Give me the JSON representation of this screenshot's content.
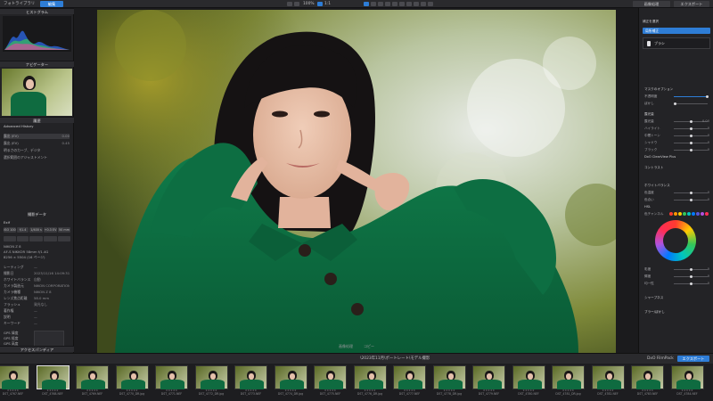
{
  "topbar": {
    "app_tab": "フォトライブラリ",
    "edit_tab": "編集",
    "zoom": "100%",
    "fit": "1:1",
    "right_button_1": "画像処理",
    "right_button_2": "エクスポート",
    "right_button_3": "テスト"
  },
  "left": {
    "histogram_title": "ヒストグラム",
    "navigator_title": "ナビゲーター",
    "history_title": "履歴",
    "history_group": "Advanced History",
    "history_items": [
      {
        "label": "露出 (EV)",
        "value": "0.00"
      },
      {
        "label": "露出 (EV)",
        "value": "0.45"
      },
      {
        "label": "明るさのカーブ、デジタ",
        "value": ""
      },
      {
        "label": "選択範囲のアジャストメント",
        "value": ""
      }
    ],
    "meta_title": "撮影データ",
    "exif_label": "Exif",
    "exif_chips": [
      "ISO 100",
      "f/1.4",
      "1/400 s",
      "+0.3 EV",
      "50 mm"
    ],
    "camera": "NIKON Z 8",
    "lens": "AF-S NIKKOR 58mm f/1.4G",
    "size": "8256 × 5504 (16 ページ)",
    "info_rows": [
      {
        "label": "レーティング",
        "value": "—"
      },
      {
        "label": "撮影日",
        "value": "2023/11/16 14:09:31"
      },
      {
        "label": "ホワイトバランス",
        "value": "自動"
      },
      {
        "label": "カメラ製造元",
        "value": "NIKON CORPORATION"
      },
      {
        "label": "カメラ機種",
        "value": "NIKON Z 8"
      },
      {
        "label": "レンズ焦点距離",
        "value": "58.0 mm"
      },
      {
        "label": "フラッシュ",
        "value": "発光なし"
      },
      {
        "label": "著作権",
        "value": "—"
      },
      {
        "label": "説明",
        "value": "—"
      },
      {
        "label": "キーワード",
        "value": "—"
      }
    ],
    "gps_rows": [
      "GPS 緯度",
      "GPS 経度",
      "GPS 高度"
    ],
    "bottom_title": "アクセスパンディア"
  },
  "right": {
    "title": "補正を選択",
    "mode": "局所補正",
    "tool": "ブラシ",
    "section1": "マスクのオプション",
    "opacity_label": "不透明度",
    "feather_label": "ぼかし",
    "section2": "露光量",
    "rows": [
      {
        "label": "露光量",
        "value": "0.00"
      },
      {
        "label": "ハイライト",
        "value": "0"
      },
      {
        "label": "中間トーン",
        "value": "0"
      },
      {
        "label": "シャドウ",
        "value": "0"
      },
      {
        "label": "ブラック",
        "value": "0"
      }
    ],
    "section3": "DxO ClearView Plus",
    "section4": "コントラスト",
    "section5": "ホワイトバランス",
    "wb_rows": [
      {
        "label": "色温度",
        "value": "0"
      },
      {
        "label": "色合い",
        "value": "0"
      }
    ],
    "section6": "HSL",
    "color_label": "色チャンネル",
    "hsl_rows": [
      {
        "label": "彩度",
        "value": "0"
      },
      {
        "label": "輝度",
        "value": "0"
      },
      {
        "label": "均一性",
        "value": "0"
      }
    ],
    "section7": "シャープネス",
    "section8": "ブラー/ぼかし",
    "swatch_colors": [
      "#ff3b30",
      "#ff9500",
      "#ffcc00",
      "#34c759",
      "#00c7be",
      "#007aff",
      "#5856d6",
      "#af52de",
      "#ff2d55"
    ]
  },
  "filmbar": {
    "path": "\\2023年11月\\ポートレート\\モデル撮影",
    "center_a": "画像処理",
    "center_b": "コピー",
    "collection": "DxO FilmPack",
    "export_btn": "エクスポート"
  },
  "film": [
    {
      "name": "DST_4767.NEF"
    },
    {
      "name": "DST_4768.NEF"
    },
    {
      "name": "DST_4769.NEF"
    },
    {
      "name": "DST_4770_DR.jpg"
    },
    {
      "name": "DST_4771.NEF"
    },
    {
      "name": "DST_4772_DR.jpg"
    },
    {
      "name": "DST_4773.NEF"
    },
    {
      "name": "DST_4774_DR.jpg"
    },
    {
      "name": "DST_4775.NEF"
    },
    {
      "name": "DST_4776_DR.jpg"
    },
    {
      "name": "DST_4777.NEF"
    },
    {
      "name": "DST_4778_DR.jpg"
    },
    {
      "name": "DST_4779.NEF"
    },
    {
      "name": "DST_4780.NEF"
    },
    {
      "name": "DST_4781_DR.jpg"
    },
    {
      "name": "DST_4782.NEF"
    },
    {
      "name": "DST_4783.NEF"
    },
    {
      "name": "DST_4784.NEF"
    }
  ]
}
